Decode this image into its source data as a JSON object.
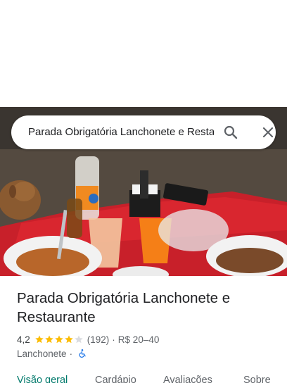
{
  "search": {
    "query": "Parada Obrigatória Lanchonete e Restaurante"
  },
  "photo": {
    "description_icon": "food-photo"
  },
  "place": {
    "name": "Parada Obrigatória Lanchonete e Restaurante",
    "rating": "4,2",
    "rating_value": 4.2,
    "reviews": "(192)",
    "price": "R$ 20–40",
    "category": "Lanchonete",
    "dot": "·"
  },
  "tabs": [
    {
      "label": "Visão geral",
      "active": true
    },
    {
      "label": "Cardápio",
      "active": false
    },
    {
      "label": "Avaliações",
      "active": false
    },
    {
      "label": "Sobre",
      "active": false
    }
  ],
  "colors": {
    "star": "#fbbc04",
    "star_empty": "#dadce0",
    "accent": "#00796b",
    "access": "#1a73e8"
  }
}
